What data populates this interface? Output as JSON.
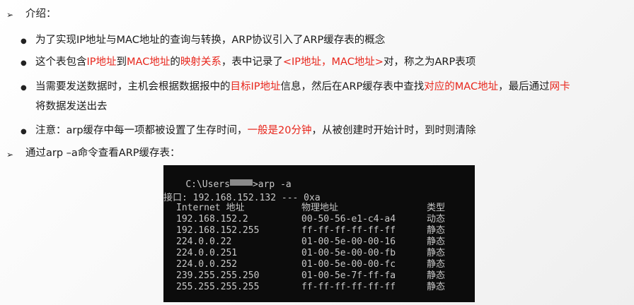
{
  "section1": {
    "heading": "介绍："
  },
  "bullets": [
    {
      "parts": [
        {
          "t": "为了实现IP地址与MAC地址的查询与转换，ARP协议引入了ARP缓存表的概念",
          "r": false
        }
      ]
    },
    {
      "parts": [
        {
          "t": "这个表包含",
          "r": false
        },
        {
          "t": "IP地址",
          "r": true
        },
        {
          "t": "到",
          "r": false
        },
        {
          "t": "MAC地址",
          "r": true
        },
        {
          "t": "的",
          "r": false
        },
        {
          "t": "映射关系",
          "r": true
        },
        {
          "t": "，表中记录了",
          "r": false
        },
        {
          "t": "<IP地址，MAC地址>",
          "r": true
        },
        {
          "t": "对，称之为ARP表项",
          "r": false
        }
      ]
    },
    {
      "parts": [
        {
          "t": "当需要发送数据时，主机会根据数据报中的",
          "r": false
        },
        {
          "t": "目标IP地址",
          "r": true
        },
        {
          "t": "信息，然后在ARP缓存表中查找",
          "r": false
        },
        {
          "t": "对应的MAC地址",
          "r": true
        },
        {
          "t": "，最后通过",
          "r": false
        },
        {
          "t": "网卡",
          "r": true
        }
      ],
      "cont": "将数据发送出去"
    },
    {
      "parts": [
        {
          "t": "注意：arp缓存中每一项都被设置了生存时间，",
          "r": false
        },
        {
          "t": "一般是20分钟",
          "r": true
        },
        {
          "t": "，从被创建时开始计时，到时则清除",
          "r": false
        }
      ]
    }
  ],
  "section2": {
    "heading": "通过arp –a命令查看ARP缓存表："
  },
  "terminal": {
    "prompt_start": "C:\\Users",
    "prompt_end": ">arp -a",
    "interface_line": "接口: 192.168.152.132 --- 0xa",
    "headers": [
      "Internet 地址",
      "物理地址",
      "类型"
    ],
    "rows": [
      [
        "192.168.152.2",
        "00-50-56-e1-c4-a4",
        "动态"
      ],
      [
        "192.168.152.255",
        "ff-ff-ff-ff-ff-ff",
        "静态"
      ],
      [
        "224.0.0.22",
        "01-00-5e-00-00-16",
        "静态"
      ],
      [
        "224.0.0.251",
        "01-00-5e-00-00-fb",
        "静态"
      ],
      [
        "224.0.0.252",
        "01-00-5e-00-00-fc",
        "静态"
      ],
      [
        "239.255.255.250",
        "01-00-5e-7f-ff-fa",
        "静态"
      ],
      [
        "255.255.255.255",
        "ff-ff-ff-ff-ff-ff",
        "静态"
      ]
    ]
  }
}
